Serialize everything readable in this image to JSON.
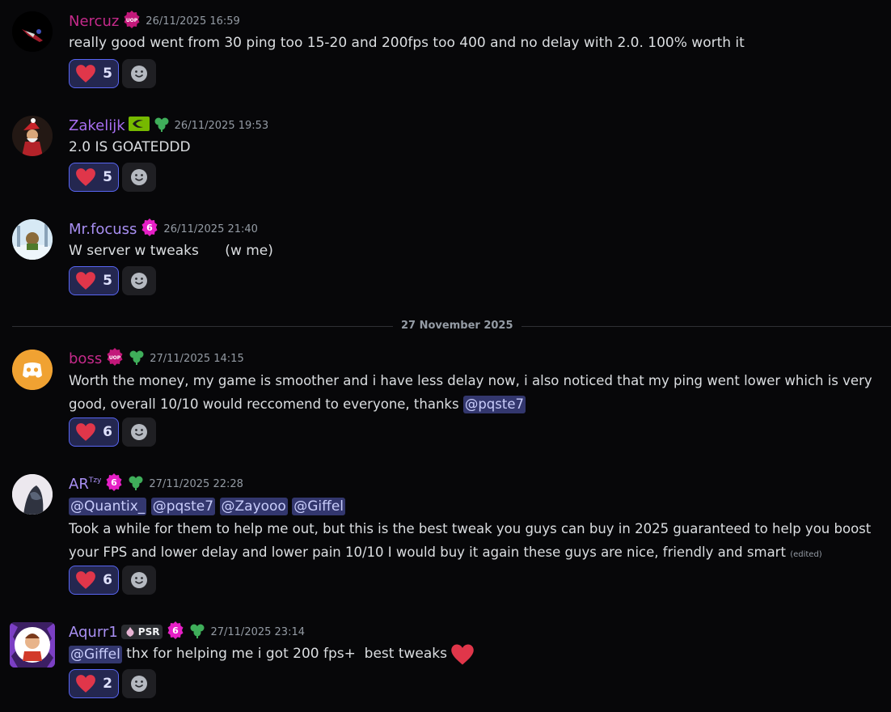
{
  "messages": [
    {
      "username": "Nercuz",
      "username_color": "#c42a8a",
      "timestamp": "26/11/2025 16:59",
      "text": "really good went from 30 ping too 15-20 and 200fps too 400 and no delay with 2.0. 100% worth it",
      "reaction_count": "5",
      "badges": [
        "uop-badge"
      ]
    },
    {
      "username": "Zakelijk",
      "username_color": "#a76ef0",
      "timestamp": "26/11/2025 19:53",
      "text": "2.0 IS GOATEDDD",
      "reaction_count": "5",
      "badges": [
        "nvidia-badge",
        "clover-badge"
      ]
    },
    {
      "username": "Mr.focuss",
      "username_color": "#a88ff2",
      "timestamp": "26/11/2025 21:40",
      "text": "W server w tweaks      (w me)",
      "reaction_count": "5",
      "badges": [
        "level-6-badge"
      ]
    },
    {
      "username": "boss",
      "username_color": "#c42a8a",
      "timestamp": "27/11/2025 14:15",
      "text": "Worth the money, my game is smoother and i have less delay now, i also noticed that my ping went lower which is very good, overall 10/10 would reccomend to everyone, thanks",
      "mention": "@pqste7",
      "reaction_count": "6",
      "badges": [
        "uop-badge",
        "clover-badge"
      ]
    },
    {
      "username": "AR",
      "username_sup": "Tzy",
      "username_color": "#a88ff2",
      "timestamp": "27/11/2025 22:28",
      "mentions": [
        "@Quantix_",
        "@pqste7",
        "@Zayooo",
        "@Giffel"
      ],
      "text": "Took a while for them to help me out, but this is the best tweak you guys can buy in 2025 guaranteed to help you boost your FPS and lower delay and lower pain 10/10 I would buy it again these guys are nice, friendly and smart",
      "edited": "(edited)",
      "reaction_count": "6",
      "badges": [
        "level-6-badge",
        "clover-badge"
      ]
    },
    {
      "username": "Aqurr1",
      "username_color": "#a88ff2",
      "timestamp": "27/11/2025 23:14",
      "tag": "PSR",
      "mention": "@Giffel",
      "text": " thx for helping me i got 200 fps+  best tweaks",
      "reaction_count": "2",
      "badges": [
        "psr-tag",
        "level-6-badge",
        "clover-badge"
      ]
    }
  ],
  "date_divider": "27 November 2025",
  "badge_labels": {
    "uop": "UOP",
    "level": "6"
  },
  "colors": {
    "heart": "#e0364a",
    "background": "#070709",
    "mention_bg": "#33376e",
    "reaction_border": "#5865f2"
  },
  "icons": {
    "reaction": "red-heart-icon",
    "add_reaction": "smiley-icon",
    "inline_emoji": "red-heart-icon"
  }
}
